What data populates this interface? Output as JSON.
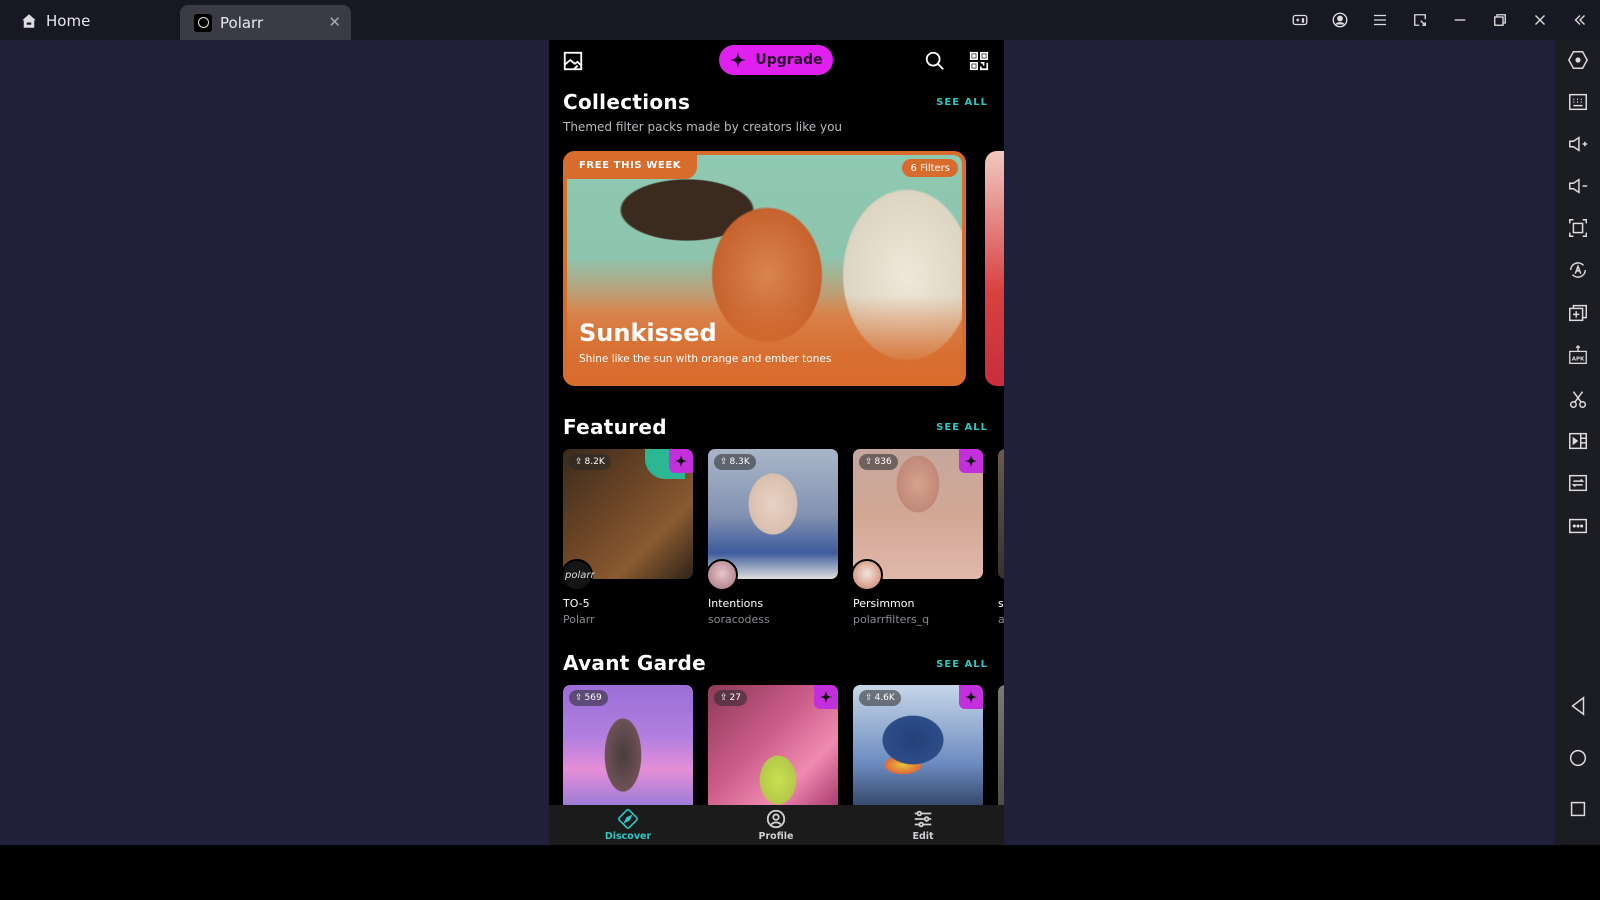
{
  "window": {
    "tabs": [
      {
        "label": "Home",
        "icon": "home-icon"
      },
      {
        "label": "Polarr",
        "icon": "polarr-app-icon",
        "close": "✕"
      }
    ],
    "controls": [
      "gamepad-icon",
      "account-icon",
      "menu-icon",
      "resize-icon",
      "minimize-icon",
      "restore-icon",
      "close-icon",
      "collapse-sidebar-icon"
    ]
  },
  "sidebar": {
    "tools": [
      "settings-hex-icon",
      "keyboard-icon",
      "volume-up-icon",
      "volume-down-icon",
      "screenshot-icon",
      "auto-rotate-icon",
      "multi-instance-icon",
      "install-apk-icon",
      "scissors-icon",
      "record-icon",
      "sync-icon",
      "more-icon"
    ],
    "nav": [
      "back-icon",
      "home-circle-icon",
      "recents-square-icon"
    ]
  },
  "app": {
    "topbar": {
      "upgrade_label": "Upgrade"
    },
    "colors": {
      "accent": "#2fc7c2",
      "upgrade": "#e020ef",
      "pro": "#c42fdc",
      "collection": "#d86c2c"
    },
    "collections": {
      "title": "Collections",
      "see_all": "SEE ALL",
      "subtitle": "Themed filter packs made by creators like you",
      "card": {
        "badge": "FREE THIS WEEK",
        "filters": "6 Filters",
        "title": "Sunkissed",
        "description": "Shine like the sun with orange and ember tones"
      }
    },
    "featured": {
      "title": "Featured",
      "see_all": "SEE ALL",
      "items": [
        {
          "count": "8.2K",
          "pro": true,
          "name": "TO-5",
          "author": "Polarr"
        },
        {
          "count": "8.3K",
          "pro": false,
          "name": "Intentions",
          "author": "soracodess"
        },
        {
          "count": "836",
          "pro": true,
          "name": "Persimmon",
          "author": "polarrfilters_q"
        }
      ],
      "peek": {
        "name": "si",
        "author": "a"
      }
    },
    "avant_garde": {
      "title": "Avant Garde",
      "see_all": "SEE ALL",
      "items": [
        {
          "count": "569",
          "pro": false
        },
        {
          "count": "27",
          "pro": true
        },
        {
          "count": "4.6K",
          "pro": true
        }
      ]
    },
    "bottom_nav": [
      {
        "label": "Discover",
        "icon": "compass-icon",
        "active": true
      },
      {
        "label": "Profile",
        "icon": "profile-icon",
        "active": false
      },
      {
        "label": "Edit",
        "icon": "sliders-icon",
        "active": false
      }
    ]
  }
}
